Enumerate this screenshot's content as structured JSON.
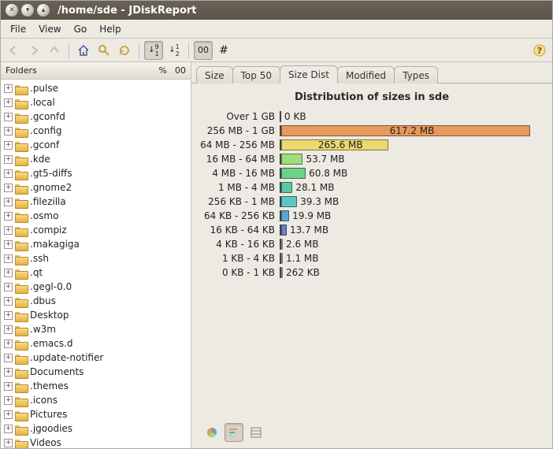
{
  "window": {
    "title": "/home/sde - JDiskReport"
  },
  "menu": {
    "file": "File",
    "view": "View",
    "go": "Go",
    "help": "Help"
  },
  "toolbar": {
    "back": "←",
    "forward": "→",
    "up": "↑",
    "home": "⌂",
    "search": "🔍",
    "refresh": "🔄",
    "sort_numeric": "↓1",
    "sort_alpha": "↓a",
    "view_grid": "00",
    "view_hash": "#",
    "helpbtn": "?"
  },
  "sidebar": {
    "header": {
      "label": "Folders",
      "pct": "%",
      "num": "00"
    },
    "items": [
      {
        "name": ".pulse"
      },
      {
        "name": ".local"
      },
      {
        "name": ".gconfd"
      },
      {
        "name": ".config"
      },
      {
        "name": ".gconf"
      },
      {
        "name": ".kde"
      },
      {
        "name": ".gt5-diffs"
      },
      {
        "name": ".gnome2"
      },
      {
        "name": ".filezilla"
      },
      {
        "name": ".osmo"
      },
      {
        "name": ".compiz"
      },
      {
        "name": ".makagiga"
      },
      {
        "name": ".ssh"
      },
      {
        "name": ".qt"
      },
      {
        "name": ".gegl-0.0"
      },
      {
        "name": ".dbus"
      },
      {
        "name": "Desktop"
      },
      {
        "name": ".w3m"
      },
      {
        "name": ".emacs.d"
      },
      {
        "name": ".update-notifier"
      },
      {
        "name": "Documents"
      },
      {
        "name": ".themes"
      },
      {
        "name": ".icons"
      },
      {
        "name": "Pictures"
      },
      {
        "name": ".jgoodies"
      },
      {
        "name": "Videos"
      }
    ]
  },
  "tabs": [
    {
      "label": "Size"
    },
    {
      "label": "Top 50"
    },
    {
      "label": "Size Dist",
      "active": true
    },
    {
      "label": "Modified"
    },
    {
      "label": "Types"
    }
  ],
  "chart_title": "Distribution of sizes in sde",
  "chart_data": {
    "type": "bar",
    "title": "Distribution of sizes in sde",
    "xlabel": "",
    "ylabel": "",
    "categories": [
      "Over 1 GB",
      "256 MB - 1 GB",
      "64 MB - 256 MB",
      "16 MB - 64 MB",
      "4 MB - 16 MB",
      "1 MB - 4 MB",
      "256 KB - 1 MB",
      "64 KB - 256 KB",
      "16 KB - 64 KB",
      "4 KB - 16 KB",
      "1 KB - 4 KB",
      "0 KB - 1 KB"
    ],
    "values_label": [
      "0 KB",
      "617.2 MB",
      "265.6 MB",
      "53.7 MB",
      "60.8 MB",
      "28.1 MB",
      "39.3 MB",
      "19.9 MB",
      "13.7 MB",
      "2.6 MB",
      "1.1 MB",
      "262 KB"
    ],
    "values_mb": [
      0,
      617.2,
      265.6,
      53.7,
      60.8,
      28.1,
      39.3,
      19.9,
      13.7,
      2.6,
      1.1,
      0.256
    ],
    "max_display_mb": 617.2,
    "colors": [
      "#cc6666",
      "#e8995c",
      "#e9d96f",
      "#9edc7e",
      "#6fd28a",
      "#5cc9a2",
      "#5fc7c3",
      "#5ea6cf",
      "#6a7fd0",
      "#8c6fd0",
      "#b86fd0",
      "#d06fb1"
    ]
  },
  "bottom_icons": {
    "pie": "pie-icon",
    "bars": "bars-icon",
    "list": "list-icon"
  }
}
